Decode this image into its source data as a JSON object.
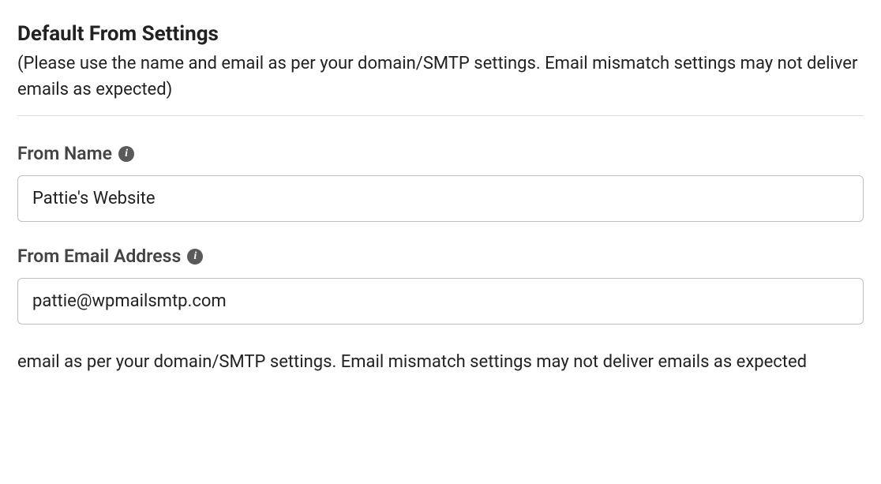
{
  "header": {
    "title": "Default From Settings",
    "subtitle": "(Please use the name and email as per your domain/SMTP settings. Email mismatch settings may not deliver emails as expected)"
  },
  "form": {
    "from_name": {
      "label": "From Name",
      "value": "Pattie's Website"
    },
    "from_email": {
      "label": "From Email Address",
      "value": "pattie@wpmailsmtp.com"
    }
  },
  "helper": {
    "text": "email as per your domain/SMTP settings. Email mismatch settings may not deliver emails as expected"
  },
  "icons": {
    "info": "i"
  }
}
